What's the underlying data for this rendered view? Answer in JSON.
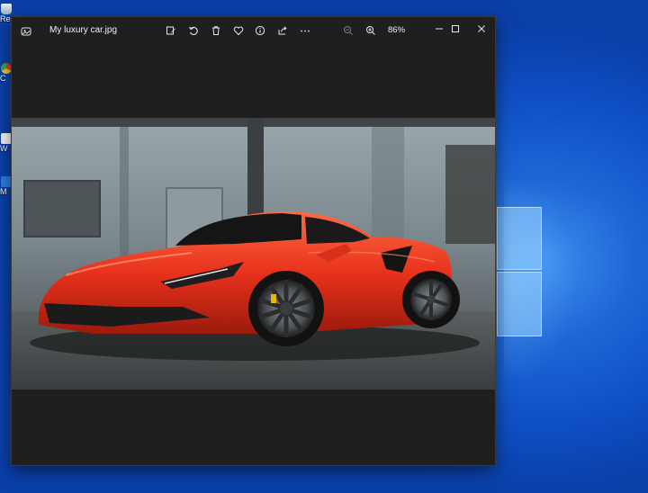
{
  "desktop": {
    "icons": [
      {
        "name": "recycle-bin",
        "label": "Re"
      },
      {
        "name": "chrome",
        "label": "C"
      },
      {
        "name": "word",
        "label": "W"
      },
      {
        "name": "microsoft-edge",
        "label": "M"
      }
    ]
  },
  "window": {
    "title": "My luxury car.jpg",
    "zoom": "86%",
    "toolbar": {
      "edit_icon": "edit-icon",
      "rotate_icon": "rotate-icon",
      "delete_icon": "delete-icon",
      "favorite_icon": "heart-icon",
      "info_icon": "info-icon",
      "share_icon": "share-icon",
      "more_icon": "more-icon",
      "zoom_out_icon": "zoom-out-icon",
      "zoom_in_icon": "zoom-in-icon"
    }
  },
  "colors": {
    "window_bg": "#1f1f1f",
    "desktop_blue": "#0e4fc4",
    "car_red": "#e8321c"
  }
}
